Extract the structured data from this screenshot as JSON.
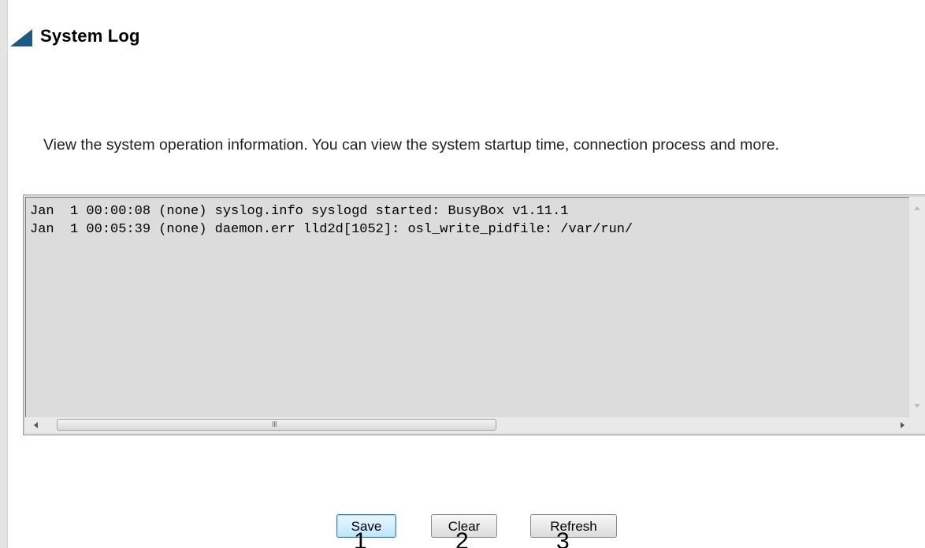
{
  "header": {
    "title": "System Log"
  },
  "description": "View the system operation information. You can view the system startup time, connection process and more.",
  "log": {
    "lines": [
      "Jan  1 00:00:08 (none) syslog.info syslogd started: BusyBox v1.11.1",
      "Jan  1 00:05:39 (none) daemon.err lld2d[1052]: osl_write_pidfile: /var/run/"
    ],
    "scroll_grip": "III"
  },
  "buttons": {
    "save_label": "Save",
    "clear_label": "Clear",
    "refresh_label": "Refresh"
  },
  "annotations": {
    "save_number": "1",
    "clear_number": "2",
    "refresh_number": "3"
  },
  "colors": {
    "title_arrow": "#1f5a84",
    "log_background": "#dcdcdc",
    "save_highlight": "#bee6fd"
  }
}
